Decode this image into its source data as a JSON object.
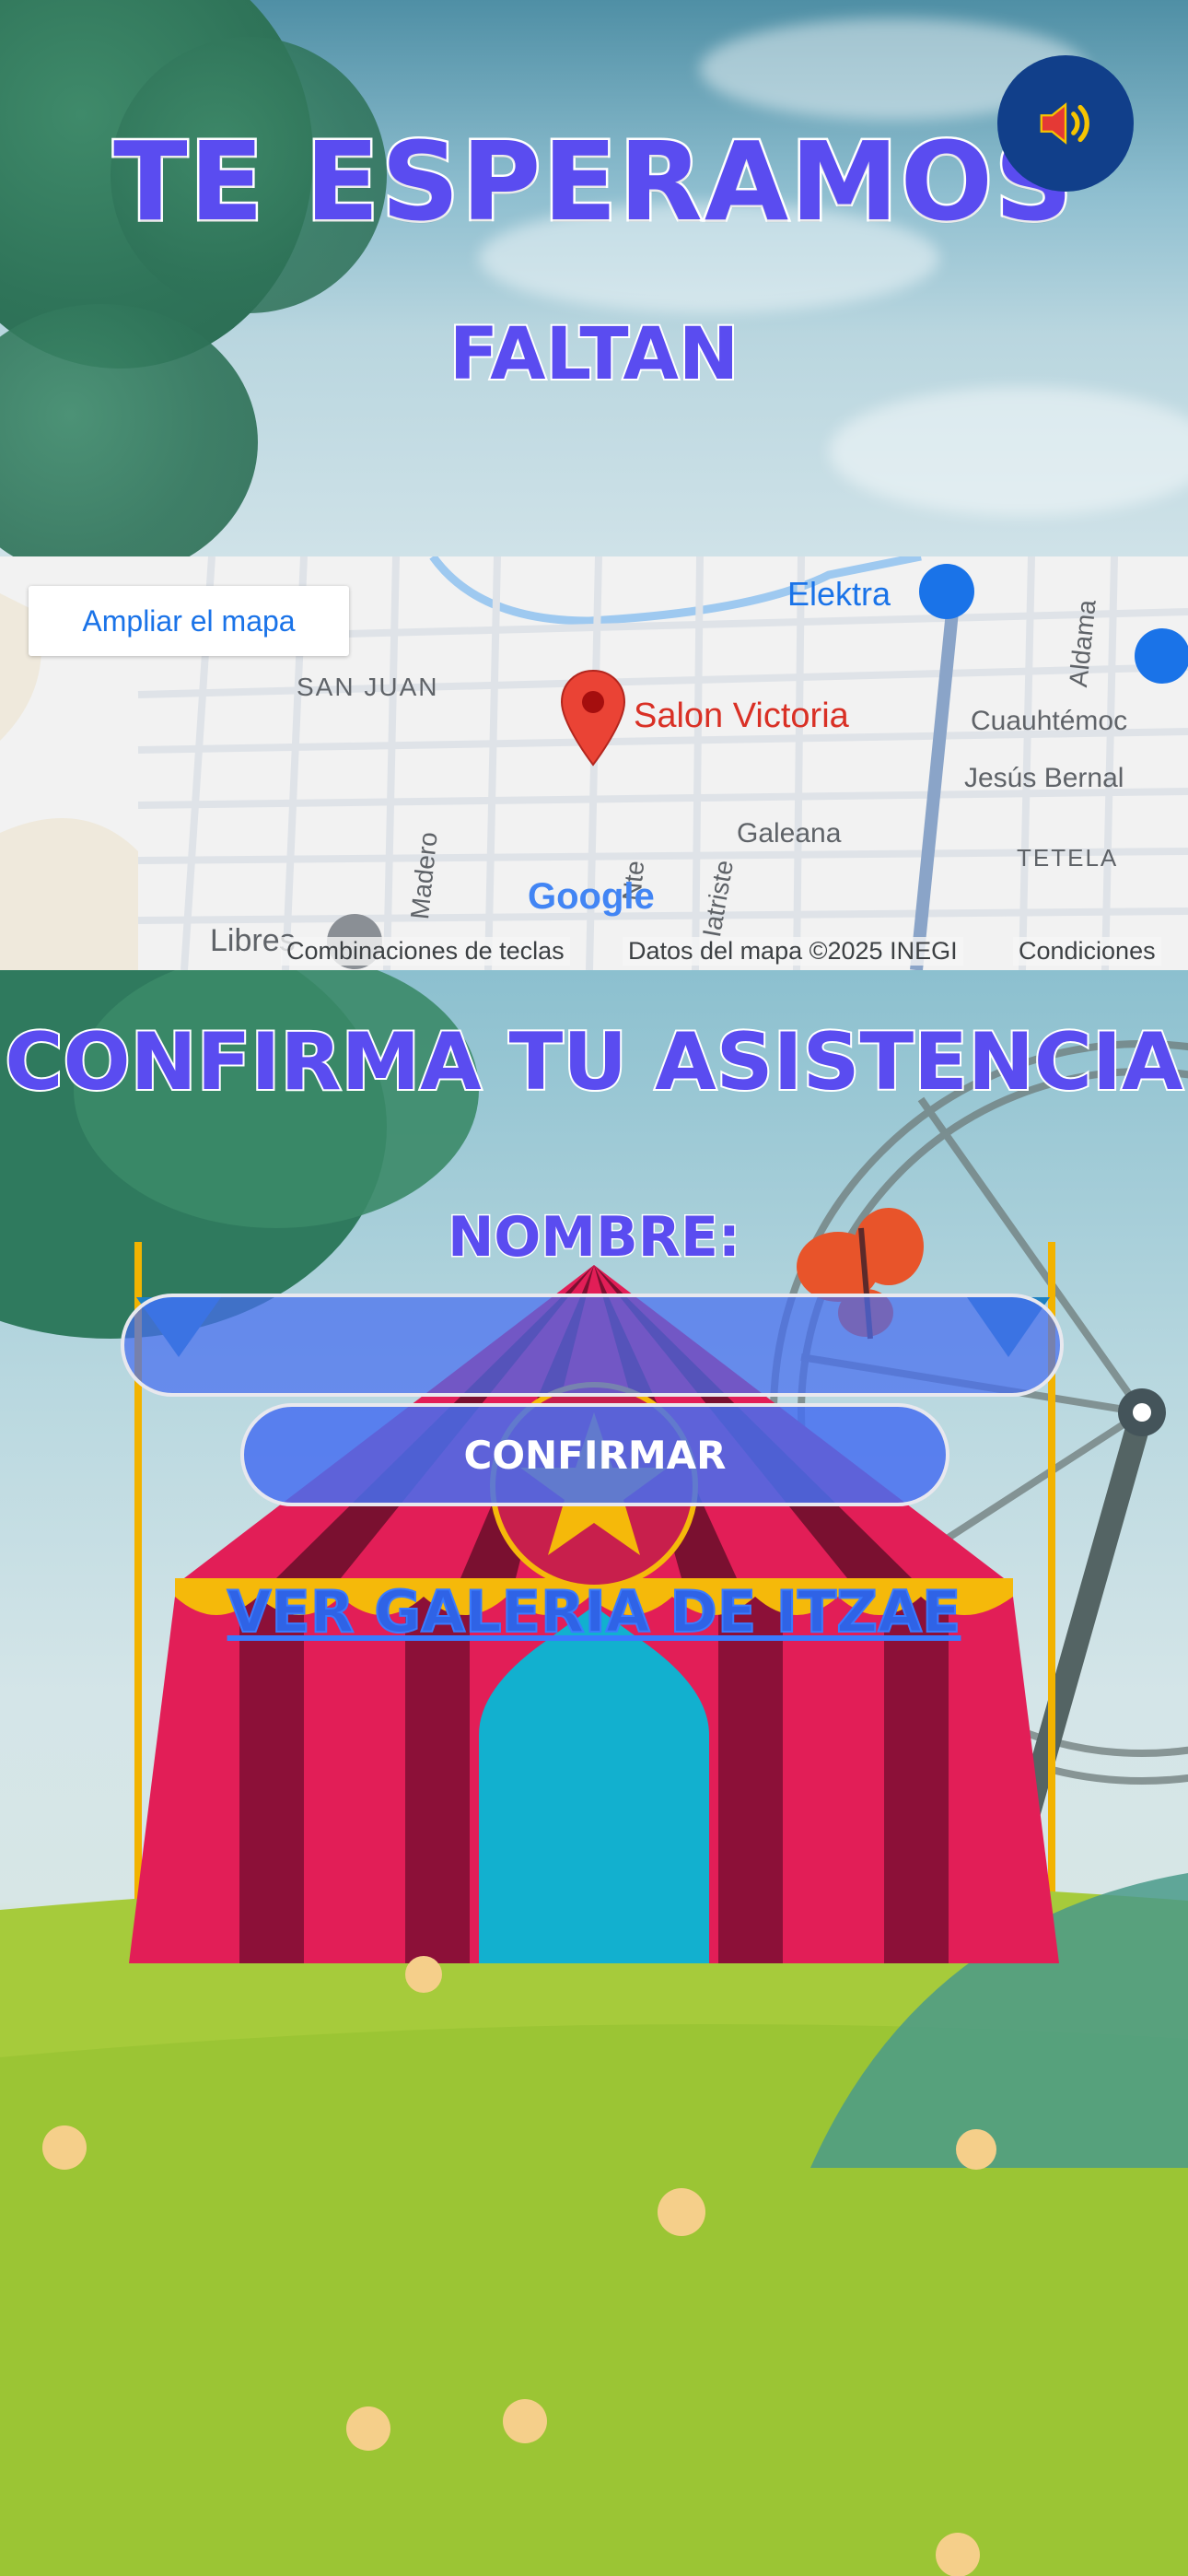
{
  "hero": {
    "title": "TE ESPERAMOS",
    "subtitle": "FALTAN",
    "sound_icon": "speaker-volume-icon"
  },
  "map": {
    "enlarge_button": "Ampliar el mapa",
    "marker_label": "Salon Victoria",
    "marker_icon": "map-pin-icon",
    "labels": {
      "elektra": "Elektra",
      "san_juan": "SAN JUAN",
      "aldama": "Aldama",
      "cuauhtemoc": "Cuauhtémoc",
      "jesus_bernal": "Jesús Bernal",
      "galeana": "Galeana",
      "tetela": "TETELA",
      "madero": "Madero",
      "nte": "Nte",
      "iatriste": "Iatriste",
      "libres": "Libres",
      "google": "Google"
    },
    "footer": {
      "shortcuts": "Combinaciones de teclas",
      "data": "Datos del mapa ©2025 INEGI",
      "terms": "Condiciones"
    }
  },
  "rsvp": {
    "title": "CONFIRMA TU ASISTENCIA",
    "name_label": "NOMBRE:",
    "name_value": "",
    "confirm_button": "CONFIRMAR",
    "gallery_link": "VER GALERIA DE ITZAE"
  },
  "colors": {
    "title_purple": "#5a4cf0",
    "sound_button": "#113f8a",
    "map_link_blue": "#1a73e8",
    "marker_red": "#ea4335"
  }
}
